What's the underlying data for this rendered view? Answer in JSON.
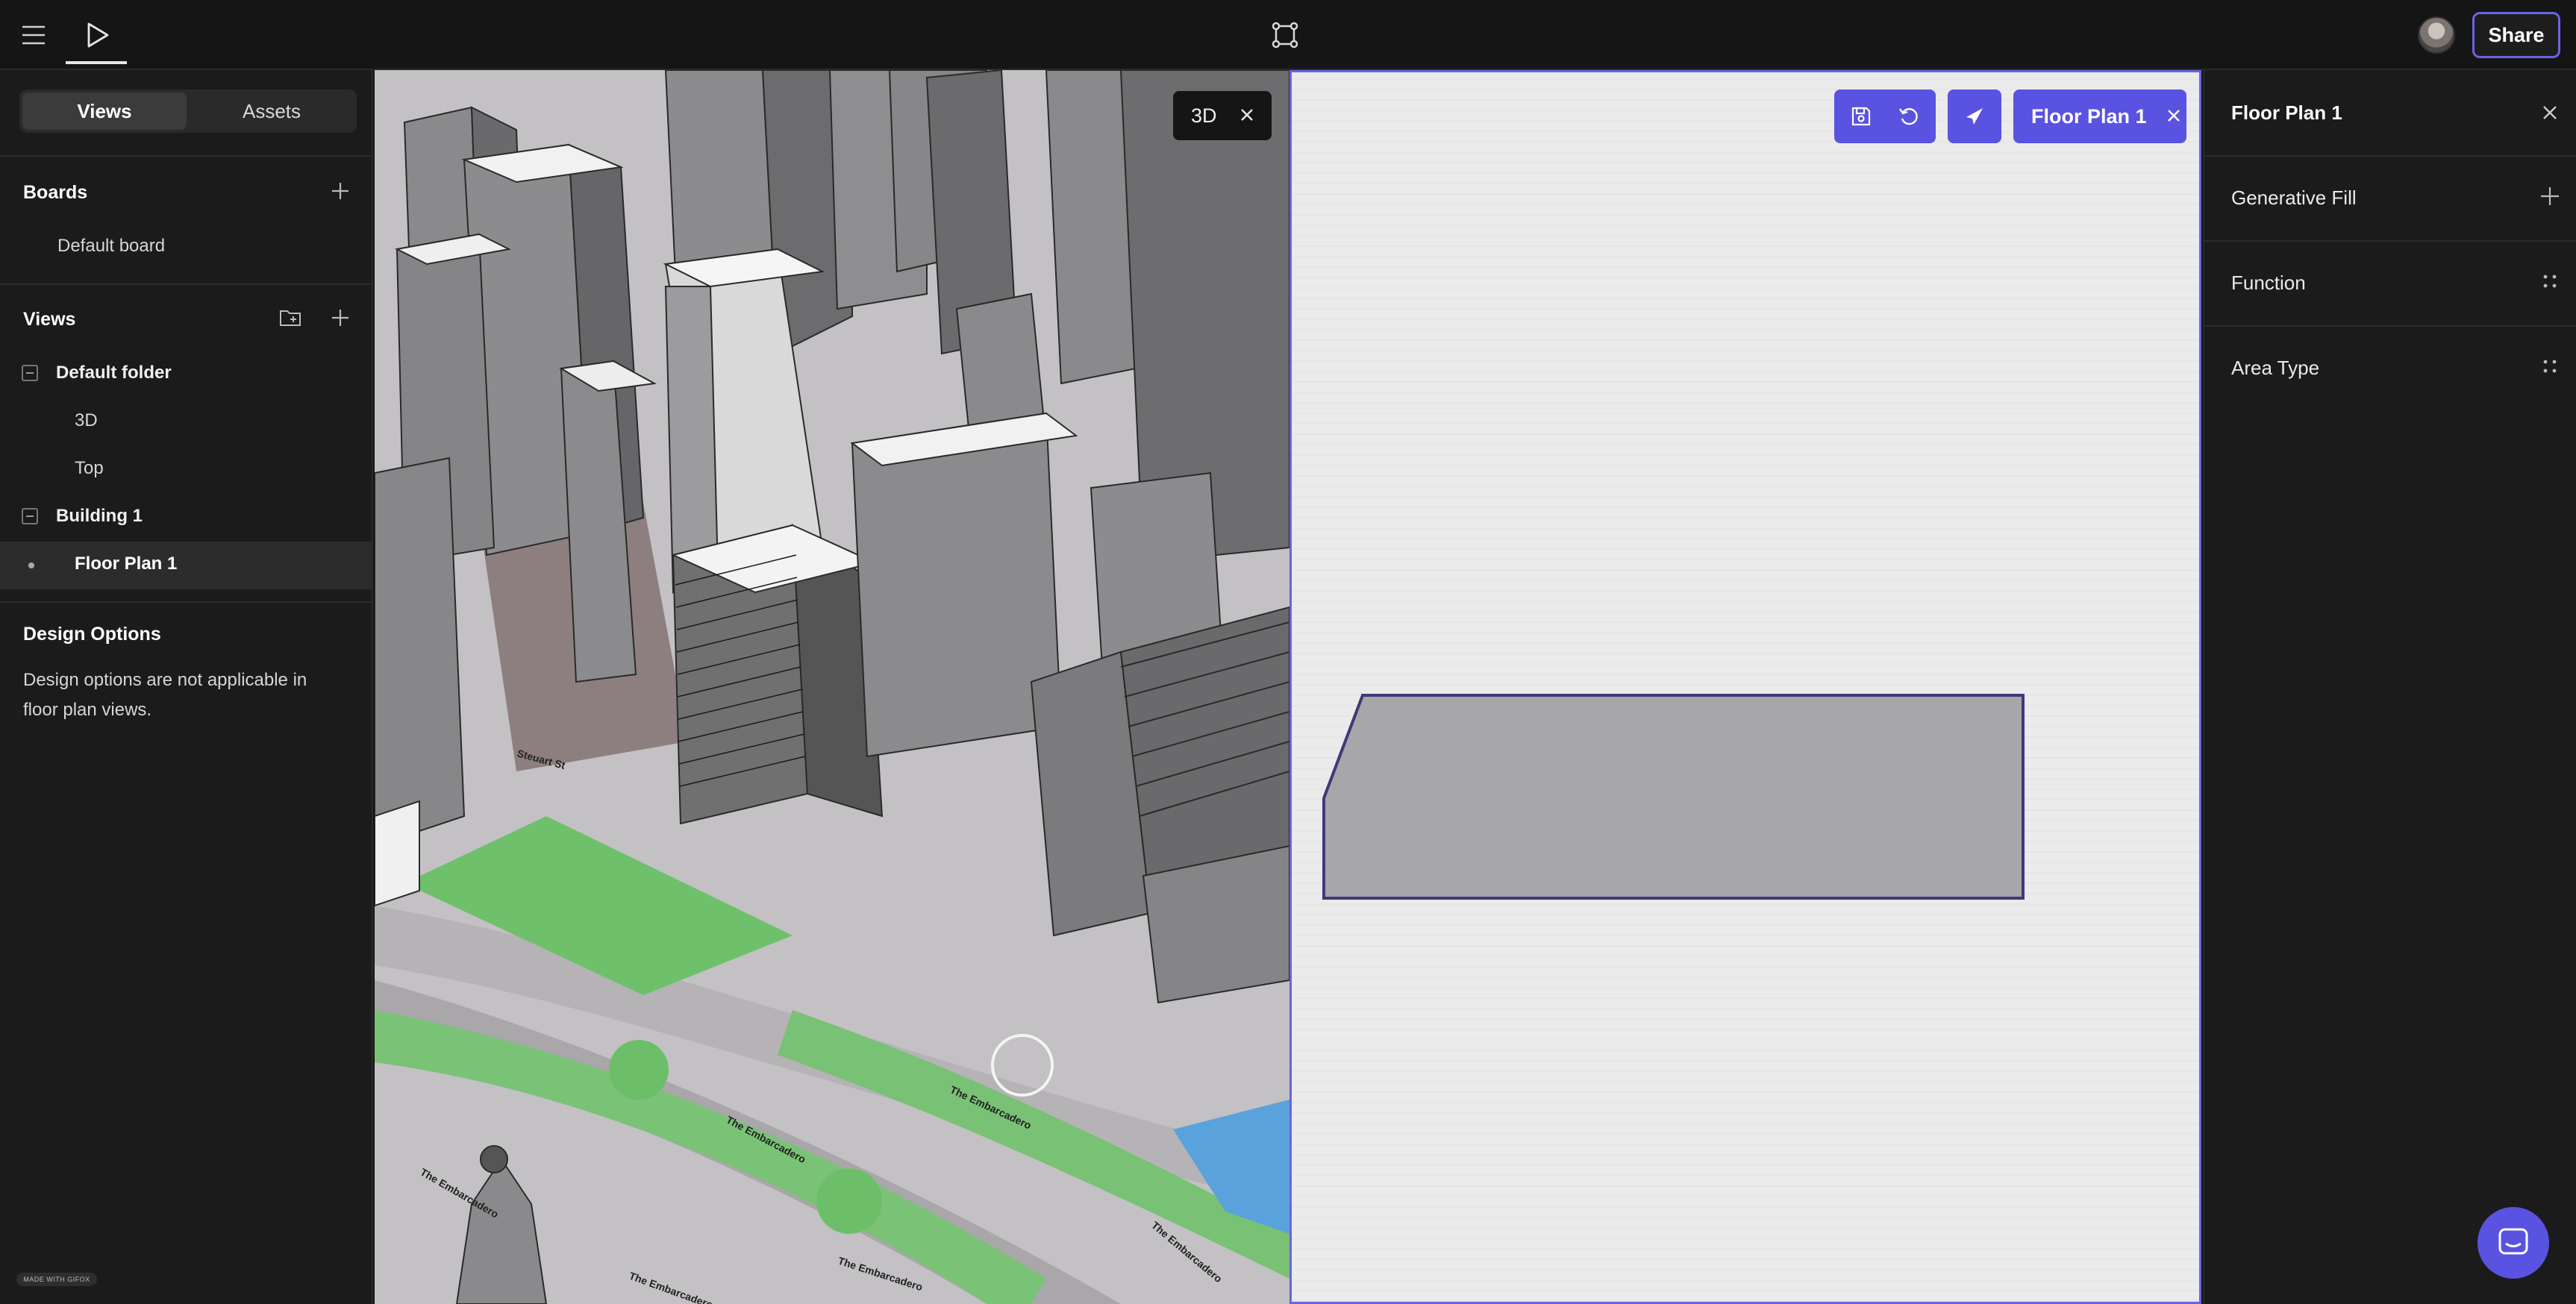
{
  "left_panel": {
    "tabs": [
      "Views",
      "Assets"
    ],
    "boards": {
      "title": "Boards",
      "items": [
        "Default board"
      ]
    },
    "views": {
      "title": "Views",
      "folders": [
        {
          "label": "Default folder",
          "items": [
            "3D",
            "Top"
          ]
        },
        {
          "label": "Building 1",
          "items": [
            "Floor Plan 1"
          ]
        }
      ]
    },
    "design_options": {
      "title": "Design Options",
      "text_line1": "Design options are not applicable in",
      "text_line2": "floor plan views."
    },
    "badge": "MADE WITH GIFOX"
  },
  "header": {
    "share_label": "Share",
    "icons": [
      "menu-icon",
      "play-icon",
      "frame-icon",
      "avatar"
    ]
  },
  "viewport_3d": {
    "tab_label": "3D",
    "street_labels": [
      "The Embarcadero",
      "The Embarcadero",
      "The Embarcadero",
      "The Embarcadero",
      "The Embarcadero",
      "The Embarcadero",
      "Steuart St"
    ]
  },
  "floor_plan": {
    "tab_label": "Floor Plan 1",
    "tool_icons": [
      "save-icon",
      "undo-icon",
      "compass-icon"
    ]
  },
  "right_panel": {
    "title": "Floor Plan 1",
    "sections": [
      "Generative Fill",
      "Function",
      "Area Type"
    ]
  },
  "colors": {
    "accent": "#5a52e0",
    "panel_bg": "#1b1b1b",
    "topbar_bg": "#151515"
  }
}
